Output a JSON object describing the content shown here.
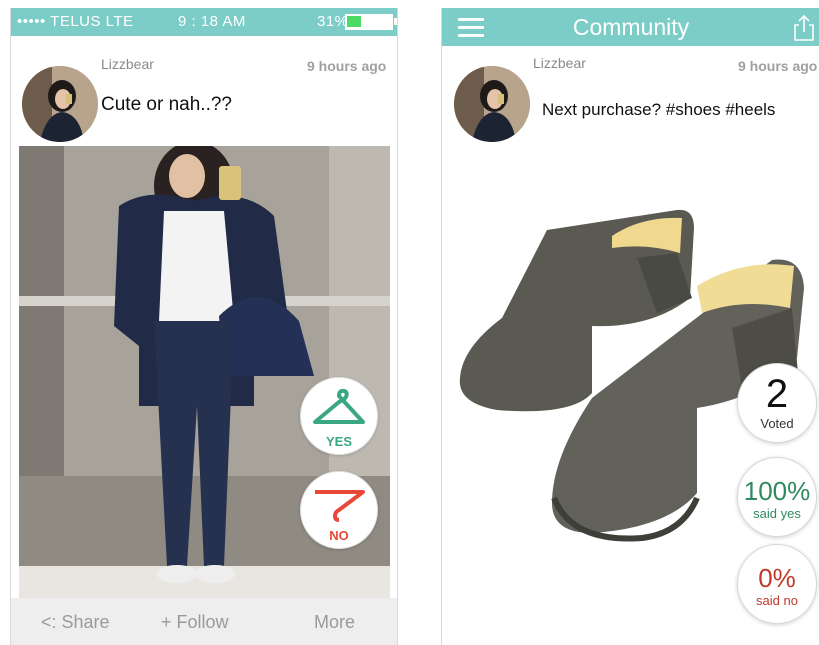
{
  "left": {
    "status_bar": {
      "carrier": "••••• TELUS  LTE",
      "time": "9 : 18 AM",
      "battery_text": "31%",
      "battery_level": 0.31
    },
    "post": {
      "username": "Lizzbear",
      "timestamp": "9 hours ago",
      "caption": "Cute or nah..??"
    },
    "vote": {
      "yes_label": "YES",
      "no_label": "NO",
      "yes_color": "#3aa784",
      "no_color": "#e8473a"
    },
    "bottom_bar": {
      "share_label": "<: Share",
      "follow_label": "+ Follow",
      "more_label": "More"
    }
  },
  "right": {
    "nav_bar": {
      "title": "Community",
      "menu_icon": "hamburger-menu-icon",
      "share_icon": "share-upload-icon"
    },
    "post": {
      "username": "Lizzbear",
      "timestamp": "9 hours ago",
      "caption": "Next purchase? #shoes #heels"
    },
    "stats": {
      "voted_count": "2",
      "voted_label": "Voted",
      "yes_percent": "100%",
      "yes_label": "said yes",
      "yes_color": "#2f8a5f",
      "no_percent": "0%",
      "no_label": "said no",
      "no_color": "#c0392b"
    }
  },
  "colors": {
    "accent": "#7ccdc7",
    "bottom_bar": "#eeeeee"
  }
}
